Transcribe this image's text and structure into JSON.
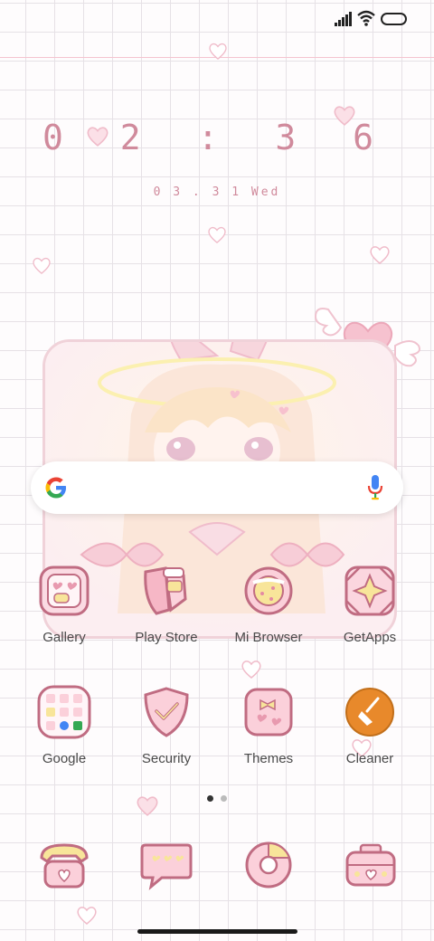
{
  "status_bar": {
    "signal_icon": "signal-bars-icon",
    "wifi_icon": "wifi-icon",
    "battery_icon": "battery-icon"
  },
  "clock": {
    "time": "02:36",
    "time_display": "0 2 : 3 6",
    "date": "03.31 Wed",
    "date_display": "0 3 . 3 1  Wed"
  },
  "search": {
    "google_icon": "google-g-icon",
    "mic_icon": "microphone-icon"
  },
  "apps_row1": [
    {
      "label": "Gallery",
      "icon": "gallery-icon"
    },
    {
      "label": "Play Store",
      "icon": "play-store-icon"
    },
    {
      "label": "Mi Browser",
      "icon": "browser-icon"
    },
    {
      "label": "GetApps",
      "icon": "getapps-icon"
    }
  ],
  "apps_row2": [
    {
      "label": "Google",
      "icon": "google-folder-icon"
    },
    {
      "label": "Security",
      "icon": "security-shield-icon"
    },
    {
      "label": "Themes",
      "icon": "themes-icon"
    },
    {
      "label": "Cleaner",
      "icon": "cleaner-broom-icon"
    }
  ],
  "dock": [
    {
      "icon": "phone-icon"
    },
    {
      "icon": "messages-icon"
    },
    {
      "icon": "chrome-icon"
    },
    {
      "icon": "camera-icon"
    }
  ],
  "page_indicator": {
    "current": 1,
    "total": 2
  },
  "colors": {
    "accent_pink": "#e6a0b2",
    "outline": "#c06c82",
    "text_pink": "#d08a9c",
    "cleaner_orange": "#e8892b"
  }
}
